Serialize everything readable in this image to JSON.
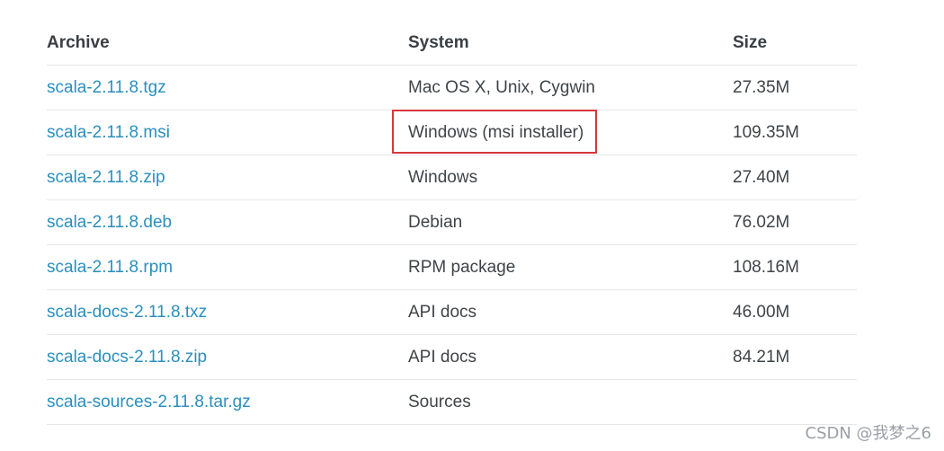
{
  "table": {
    "headers": {
      "archive": "Archive",
      "system": "System",
      "size": "Size"
    },
    "rows": [
      {
        "archive": "scala-2.11.8.tgz",
        "system": "Mac OS X, Unix, Cygwin",
        "size": "27.35M"
      },
      {
        "archive": "scala-2.11.8.msi",
        "system": "Windows (msi installer)",
        "size": "109.35M"
      },
      {
        "archive": "scala-2.11.8.zip",
        "system": "Windows",
        "size": "27.40M"
      },
      {
        "archive": "scala-2.11.8.deb",
        "system": "Debian",
        "size": "76.02M"
      },
      {
        "archive": "scala-2.11.8.rpm",
        "system": "RPM package",
        "size": "108.16M"
      },
      {
        "archive": "scala-docs-2.11.8.txz",
        "system": "API docs",
        "size": "46.00M"
      },
      {
        "archive": "scala-docs-2.11.8.zip",
        "system": "API docs",
        "size": "84.21M"
      },
      {
        "archive": "scala-sources-2.11.8.tar.gz",
        "system": "Sources",
        "size": ""
      }
    ]
  },
  "annotation": {
    "highlight_color": "#d9363e"
  },
  "colors": {
    "link": "#2a8fbd",
    "text": "#3f4448",
    "header": "#3a3f44",
    "divider": "#e6e6e6"
  },
  "watermark": {
    "text": "CSDN @我梦之6"
  }
}
